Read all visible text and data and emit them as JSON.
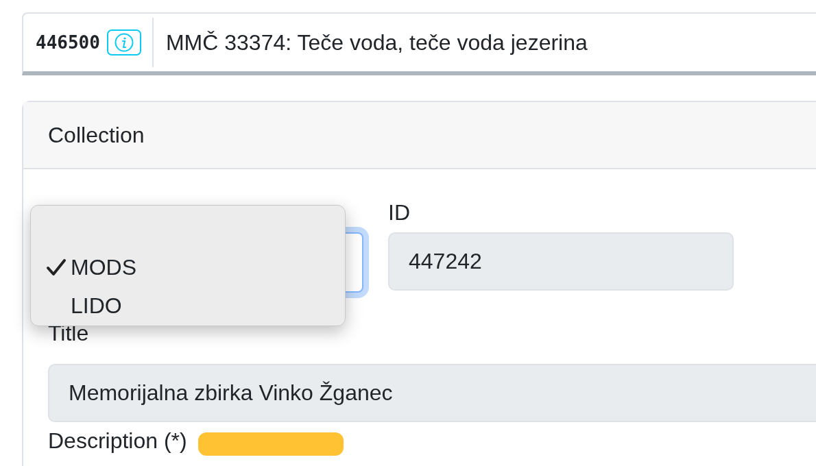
{
  "header": {
    "record_id": "446500",
    "title": "MMČ 33374: Teče voda, teče voda jezerina"
  },
  "card": {
    "title": "Collection",
    "metadata_select": {
      "options": [
        {
          "label": "MODS",
          "selected": true
        },
        {
          "label": "LIDO",
          "selected": false
        }
      ]
    },
    "id_field": {
      "label": "ID",
      "value": "447242"
    },
    "title_field": {
      "label": "Title",
      "value": "Memorijalna zbirka Vinko Žganec"
    },
    "description_field": {
      "label": "Description (*)"
    }
  }
}
